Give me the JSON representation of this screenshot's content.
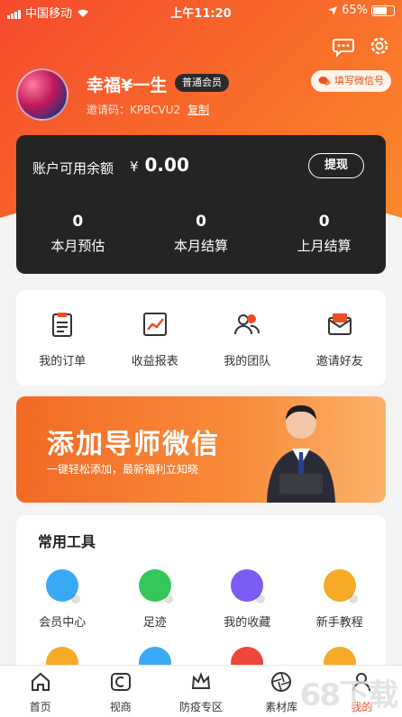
{
  "status_bar": {
    "carrier": "中国移动",
    "time": "上午11:20",
    "battery": "65%"
  },
  "profile": {
    "name": "幸福¥一生",
    "member_level": "普通会员",
    "invite_label": "邀请码：",
    "invite_code": "KPBCVU2",
    "copy_label": "复制",
    "wechat_button": "填写微信号"
  },
  "balance": {
    "label": "账户可用余额",
    "currency": "¥",
    "value": "0.00",
    "withdraw_label": "提现",
    "stats": [
      {
        "value": "0",
        "label": "本月预估"
      },
      {
        "value": "0",
        "label": "本月结算"
      },
      {
        "value": "0",
        "label": "上月结算"
      }
    ]
  },
  "quick_actions": [
    {
      "label": "我的订单",
      "icon": "order-icon"
    },
    {
      "label": "收益报表",
      "icon": "report-icon"
    },
    {
      "label": "我的团队",
      "icon": "team-icon"
    },
    {
      "label": "邀请好友",
      "icon": "invite-icon"
    }
  ],
  "banner": {
    "title": "添加导师微信",
    "subtitle": "一键轻松添加，最新福利立知晓"
  },
  "tools": {
    "title": "常用工具",
    "items": [
      {
        "label": "会员中心",
        "icon": "member-center-icon",
        "color": "#3aa9f5"
      },
      {
        "label": "足迹",
        "icon": "footprint-icon",
        "color": "#35c759"
      },
      {
        "label": "我的收藏",
        "icon": "folder-icon",
        "color": "#7b5cf5"
      },
      {
        "label": "新手教程",
        "icon": "book-icon",
        "color": "#f7a928"
      }
    ],
    "second_row_colors": [
      "#f7a928",
      "#3aa9f5",
      "#f0463a",
      "#f7a928"
    ]
  },
  "tabbar": [
    {
      "label": "首页",
      "icon": "home-icon"
    },
    {
      "label": "视商",
      "icon": "video-shop-icon"
    },
    {
      "label": "防疫专区",
      "icon": "crown-icon"
    },
    {
      "label": "素材库",
      "icon": "aperture-icon"
    },
    {
      "label": "我的",
      "icon": "user-icon",
      "active": true
    }
  ],
  "watermark": "68下载",
  "colors": {
    "brand": "#f04c25",
    "card_dark": "#242424"
  }
}
